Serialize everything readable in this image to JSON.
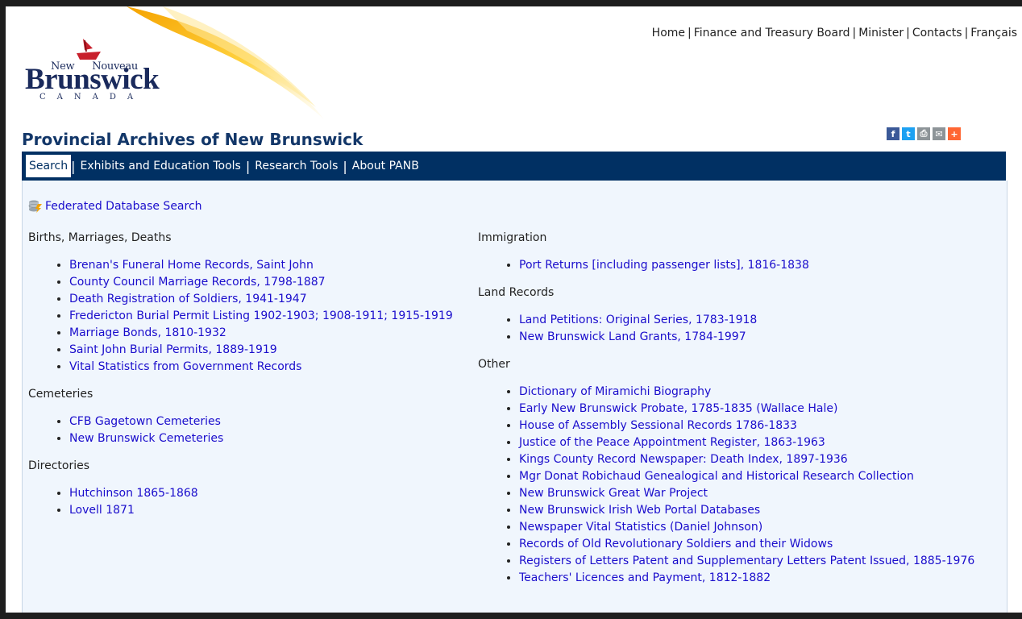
{
  "header": {
    "logo": {
      "new": "New",
      "nouveau": "Nouveau",
      "brunswick": "Brunswick",
      "canada": "CANADA"
    },
    "topnav": [
      "Home",
      "Finance and Treasury Board",
      "Minister",
      "Contacts",
      "Français"
    ],
    "page_title": "Provincial Archives of New Brunswick",
    "share_icons": [
      {
        "name": "facebook-icon",
        "color": "#3b5998",
        "glyph": "f"
      },
      {
        "name": "twitter-icon",
        "color": "#1da1f2",
        "glyph": "t"
      },
      {
        "name": "print-icon",
        "color": "#8d9498",
        "glyph": "⎙"
      },
      {
        "name": "email-icon",
        "color": "#8d9498",
        "glyph": "✉"
      },
      {
        "name": "share-plus-icon",
        "color": "#ff6633",
        "glyph": "+"
      }
    ]
  },
  "mainnav": {
    "tabs": [
      "Search",
      "Exhibits and Education Tools",
      "Research Tools",
      "About PANB"
    ],
    "active": "Search"
  },
  "content": {
    "federated_search": "Federated Database Search",
    "left_sections": [
      {
        "title": "Births, Marriages, Deaths",
        "items": [
          "Brenan's Funeral Home Records, Saint John",
          "County Council Marriage Records, 1798-1887",
          "Death Registration of Soldiers, 1941-1947",
          "Fredericton Burial Permit Listing 1902-1903; 1908-1911; 1915-1919",
          "Marriage Bonds, 1810-1932",
          "Saint John Burial Permits, 1889-1919",
          "Vital Statistics from Government Records"
        ]
      },
      {
        "title": "Cemeteries",
        "items": [
          "CFB Gagetown Cemeteries",
          "New Brunswick Cemeteries"
        ]
      },
      {
        "title": "Directories",
        "items": [
          "Hutchinson 1865-1868",
          "Lovell 1871"
        ]
      }
    ],
    "right_sections": [
      {
        "title": "Immigration",
        "items": [
          "Port Returns [including passenger lists], 1816-1838"
        ]
      },
      {
        "title": "Land Records",
        "items": [
          "Land Petitions: Original Series, 1783-1918",
          "New Brunswick Land Grants, 1784-1997"
        ]
      },
      {
        "title": "Other",
        "items": [
          "Dictionary of Miramichi Biography",
          "Early New Brunswick Probate, 1785-1835 (Wallace Hale)",
          "House of Assembly Sessional Records 1786-1833",
          "Justice of the Peace Appointment Register, 1863-1963",
          "Kings County Record Newspaper: Death Index, 1897-1936",
          "Mgr Donat Robichaud Genealogical and Historical Research Collection",
          "New Brunswick Great War Project",
          "New Brunswick Irish Web Portal Databases",
          "Newspaper Vital Statistics (Daniel Johnson)",
          "Records of Old Revolutionary Soldiers and their Widows",
          "Registers of Letters Patent and Supplementary Letters Patent Issued, 1885-1976",
          "Teachers' Licences and Payment, 1812-1882"
        ]
      }
    ]
  },
  "colors": {
    "nav_bg": "#013063",
    "title": "#133769",
    "link": "#1a0dcc",
    "content_bg": "#f0f6fd"
  }
}
